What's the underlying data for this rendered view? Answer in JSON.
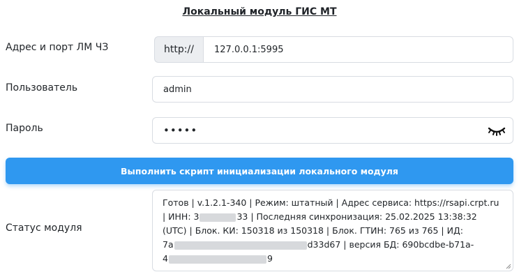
{
  "title": "Локальный модуль ГИС МТ",
  "address": {
    "label": "Адрес и порт ЛМ ЧЗ",
    "prefix": "http://",
    "value": "127.0.0.1:5995"
  },
  "user": {
    "label": "Пользователь",
    "value": "admin"
  },
  "password": {
    "label": "Пароль",
    "masked": "•••••",
    "toggle_icon": "eye-closed-icon"
  },
  "run_button": {
    "label": "Выполнить скрипт инициализации локального модуля",
    "color": "#2f98f0"
  },
  "status": {
    "label": "Статус модуля",
    "lines": [
      "Готов | v.1.2.1-340 | Режим: штатный | Адрес сервиса: https://rsapi.crpt.ru",
      "| ИНН: 3",
      "33 | Последняя синхронизация: 25.02.2025 13:38:32",
      "(UTC) | Блок. КИ: 150318 из 150318 | Блок. ГТИН: 765 из 765 | ИД:",
      "7a",
      "d33d67 | версия БД: 690bcdbe-b71a-",
      "4",
      "9"
    ]
  }
}
